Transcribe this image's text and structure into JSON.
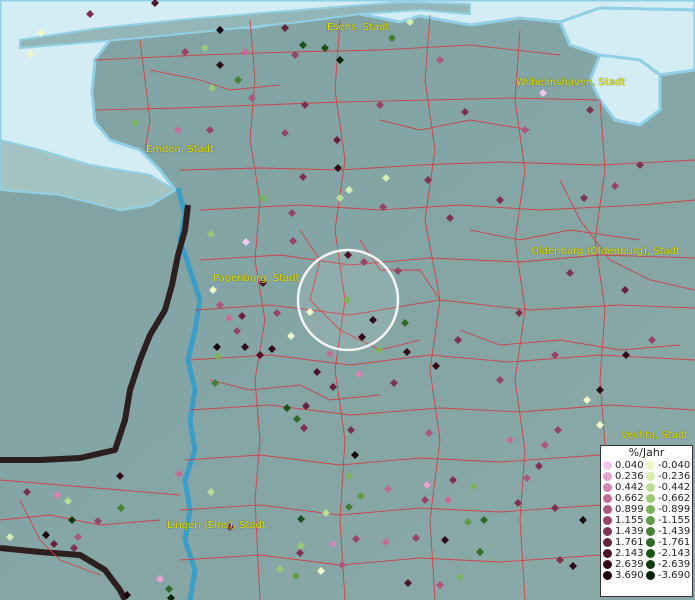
{
  "map": {
    "cities": [
      {
        "name": "Esens, Stadt",
        "anchor": "esens"
      },
      {
        "name": "Wilhelmshaven, Stadt",
        "anchor": "whv"
      },
      {
        "name": "Emden, Stadt",
        "anchor": "emden"
      },
      {
        "name": "Oldenburg (Oldenburg), Stadt",
        "anchor": "old"
      },
      {
        "name": "Papenburg, Stadt",
        "anchor": "pap"
      },
      {
        "name": "Vechta, Stadt",
        "anchor": "vechta"
      },
      {
        "name": "Lingen (Ems), Stadt",
        "anchor": "lingen"
      }
    ],
    "colors": {
      "sea": "#d6ecf2",
      "land": "#88a8a8",
      "river": "#3b9ec8",
      "border": "#e03a3a",
      "national_border": "#3a2a2a",
      "label": "#e6e600"
    }
  },
  "legend": {
    "title": "%/Jahr",
    "positive": [
      {
        "value": "0.040",
        "color": "#f6c6ea"
      },
      {
        "value": "0.236",
        "color": "#e8a2cf"
      },
      {
        "value": "0.442",
        "color": "#d883b3"
      },
      {
        "value": "0.662",
        "color": "#c46b98"
      },
      {
        "value": "0.899",
        "color": "#ae5580"
      },
      {
        "value": "1.155",
        "color": "#974268"
      },
      {
        "value": "1.439",
        "color": "#7e3150"
      },
      {
        "value": "1.761",
        "color": "#68223d"
      },
      {
        "value": "2.143",
        "color": "#4e142a"
      },
      {
        "value": "2.639",
        "color": "#330a18"
      },
      {
        "value": "3.690",
        "color": "#1a040a"
      }
    ],
    "negative": [
      {
        "value": "-0.040",
        "color": "#f0f6c8"
      },
      {
        "value": "-0.236",
        "color": "#d6ecb0"
      },
      {
        "value": "-0.442",
        "color": "#b8dc92"
      },
      {
        "value": "-0.662",
        "color": "#98ca74"
      },
      {
        "value": "-0.899",
        "color": "#79b45a"
      },
      {
        "value": "-1.155",
        "color": "#5d9b44"
      },
      {
        "value": "-1.439",
        "color": "#448232"
      },
      {
        "value": "-1.761",
        "color": "#2e6a22"
      },
      {
        "value": "-2.143",
        "color": "#1c5216"
      },
      {
        "value": "-2.639",
        "color": "#0e3a0c"
      },
      {
        "value": "-3.690",
        "color": "#052205"
      }
    ]
  }
}
